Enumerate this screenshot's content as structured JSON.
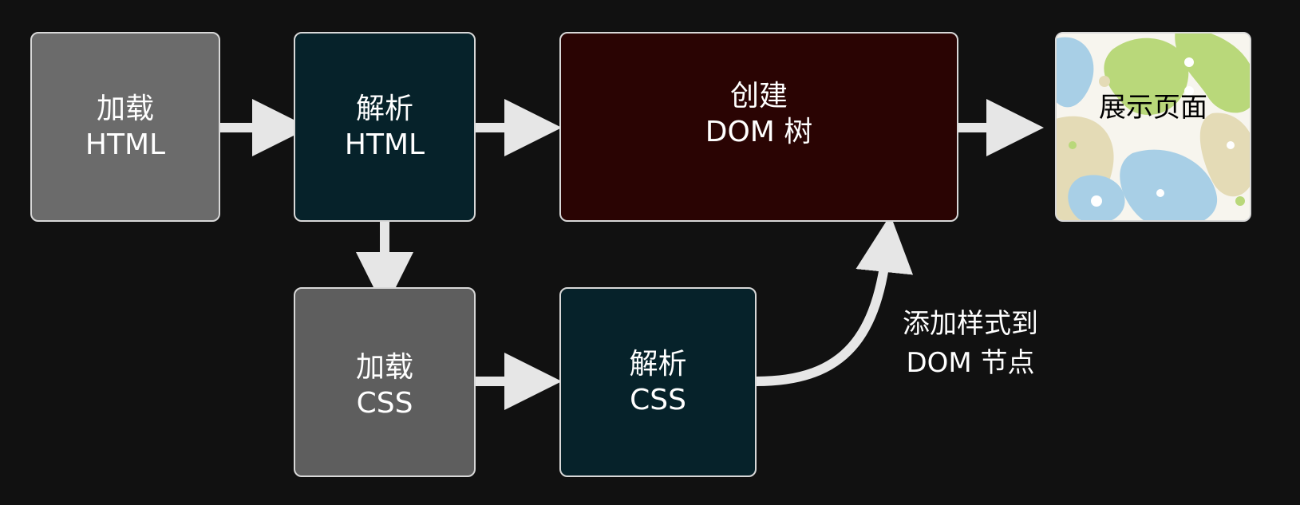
{
  "nodes": {
    "load_html": {
      "line1": "加载",
      "line2": "HTML"
    },
    "parse_html": {
      "line1": "解析",
      "line2": "HTML"
    },
    "create_dom": {
      "line1": "创建",
      "line2": "DOM 树"
    },
    "display_page": {
      "label": "展示页面"
    },
    "load_css": {
      "line1": "加载",
      "line2": "CSS"
    },
    "parse_css": {
      "line1": "解析",
      "line2": "CSS"
    }
  },
  "edge_labels": {
    "add_styles": {
      "line1": "添加样式到",
      "line2": "DOM 节点"
    }
  },
  "colors": {
    "background": "#111111",
    "arrow": "#e6e6e6",
    "gray_box": "#6b6b6b",
    "teal_box": "#06222a",
    "maroon_box": "#2a0403",
    "pattern_green": "#b9d87a",
    "pattern_blue": "#a8cfe6",
    "pattern_beige": "#e4dbb6"
  }
}
